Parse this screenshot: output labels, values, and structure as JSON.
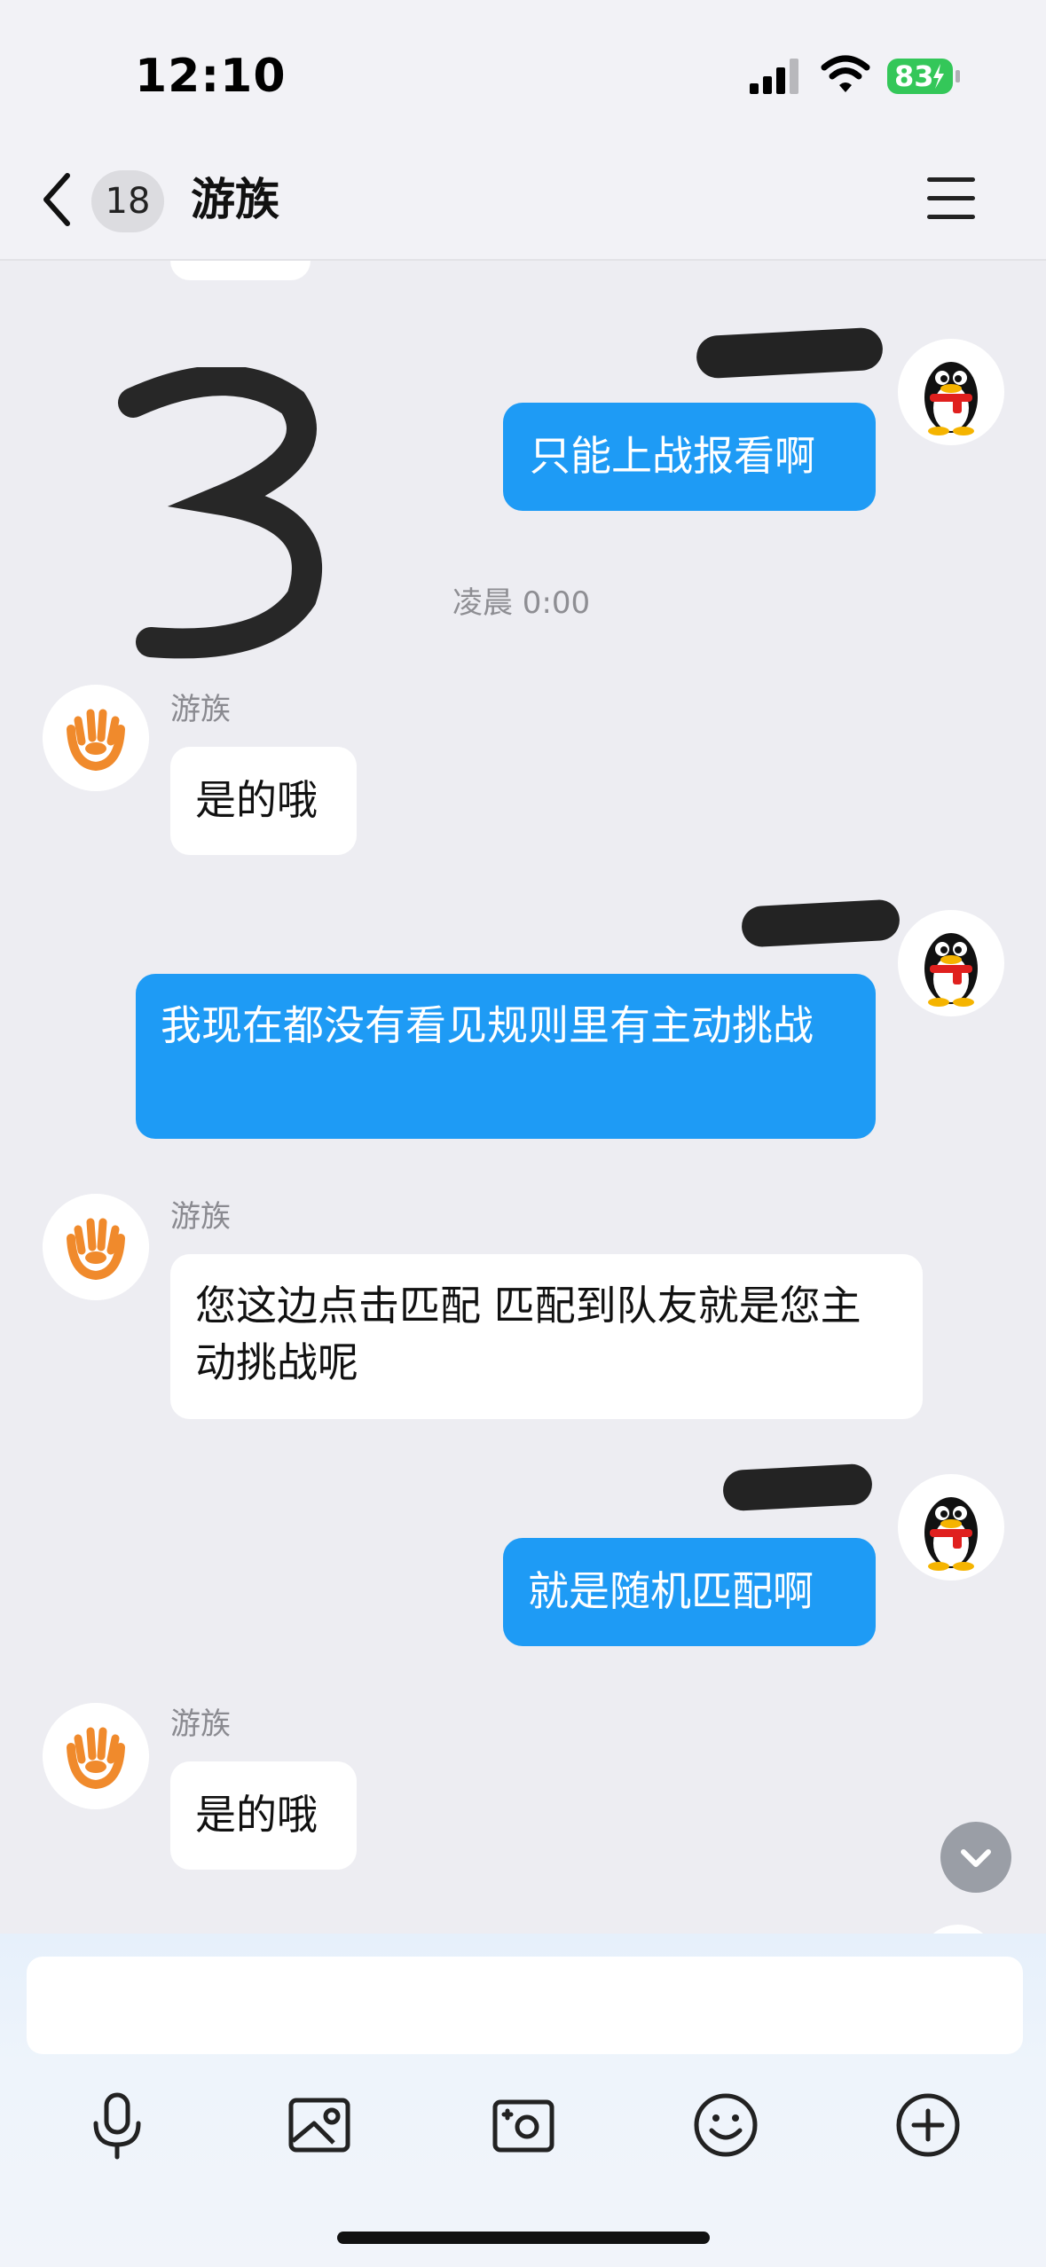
{
  "status_bar": {
    "time": "12:10",
    "battery_level": "83",
    "battery_color": "#34c759"
  },
  "nav": {
    "unread_count": "18",
    "title": "游族",
    "back_icon": "chevron-left-icon",
    "menu_icon": "hamburger-menu-icon"
  },
  "messages": [
    {
      "direction": "out",
      "text": "只能上战报看啊"
    },
    {
      "type": "timestamp",
      "text": "凌晨 0:00"
    },
    {
      "direction": "in",
      "sender": "游族",
      "text": "是的哦"
    },
    {
      "direction": "out",
      "text": "我现在都没有看见规则里有主动挑战"
    },
    {
      "direction": "in",
      "sender": "游族",
      "text": "您这边点击匹配 匹配到队友就是您主动挑战呢"
    },
    {
      "direction": "out",
      "text": "就是随机匹配啊"
    },
    {
      "direction": "in",
      "sender": "游族",
      "text": "是的哦"
    }
  ],
  "input": {
    "placeholder": ""
  },
  "toolbar": {
    "icons": [
      "microphone-icon",
      "photo-album-icon",
      "camera-icon",
      "emoji-icon",
      "plus-icon"
    ]
  },
  "colors": {
    "outgoing_bubble": "#1e9bf5",
    "incoming_bubble": "#ffffff",
    "chat_background": "#ededf2",
    "youzu_logo": "#f08a2c"
  }
}
